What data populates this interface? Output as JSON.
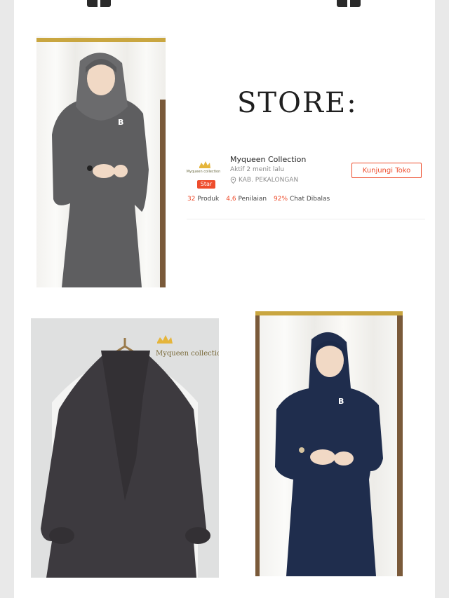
{
  "store": {
    "title": "STORE:",
    "name": "Myqueen Collection",
    "active": "Aktif 2 menit lalu",
    "location": "KAB. PEKALONGAN",
    "badge": "Star",
    "logo_text": "Myqueen collection",
    "visit_button": "Kunjungi Toko",
    "stats": [
      {
        "value": "32",
        "label": "Produk"
      },
      {
        "value": "4,6",
        "label": "Penilaian"
      },
      {
        "value": "92%",
        "label": "Chat Dibalas"
      }
    ]
  },
  "photos": {
    "hanger_watermark": "Myqueen collection",
    "badge_letter": "B"
  },
  "colors": {
    "accent": "#ee4d2d",
    "gray_outfit": "#5a5a5c",
    "navy_outfit": "#1c2a49",
    "dark_outfit": "#3b383d"
  }
}
